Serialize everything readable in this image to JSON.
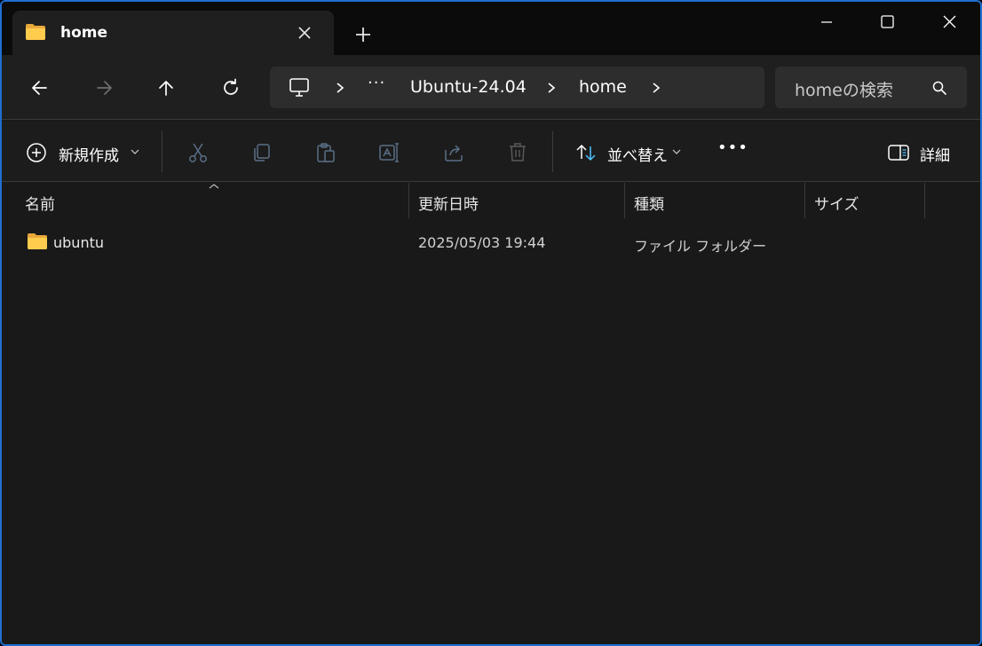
{
  "window": {
    "accent": "#1f6fd0"
  },
  "tab": {
    "title": "home",
    "icon": "folder-icon"
  },
  "nav": {
    "back": "back-arrow-icon",
    "forward": "forward-arrow-icon",
    "up": "up-arrow-icon",
    "refresh": "refresh-icon"
  },
  "address": {
    "overflow": "···",
    "crumbs": [
      "Ubuntu-24.04",
      "home"
    ]
  },
  "search": {
    "placeholder": "homeの検索"
  },
  "commands": {
    "new_label": "新規作成",
    "sort_label": "並べ替え",
    "details_label": "詳細",
    "more": "•••"
  },
  "columns": {
    "name": "名前",
    "modified": "更新日時",
    "type": "種類",
    "size": "サイズ"
  },
  "rows": [
    {
      "name": "ubuntu",
      "modified": "2025/05/03 19:44",
      "type": "ファイル フォルダー",
      "size": ""
    }
  ]
}
